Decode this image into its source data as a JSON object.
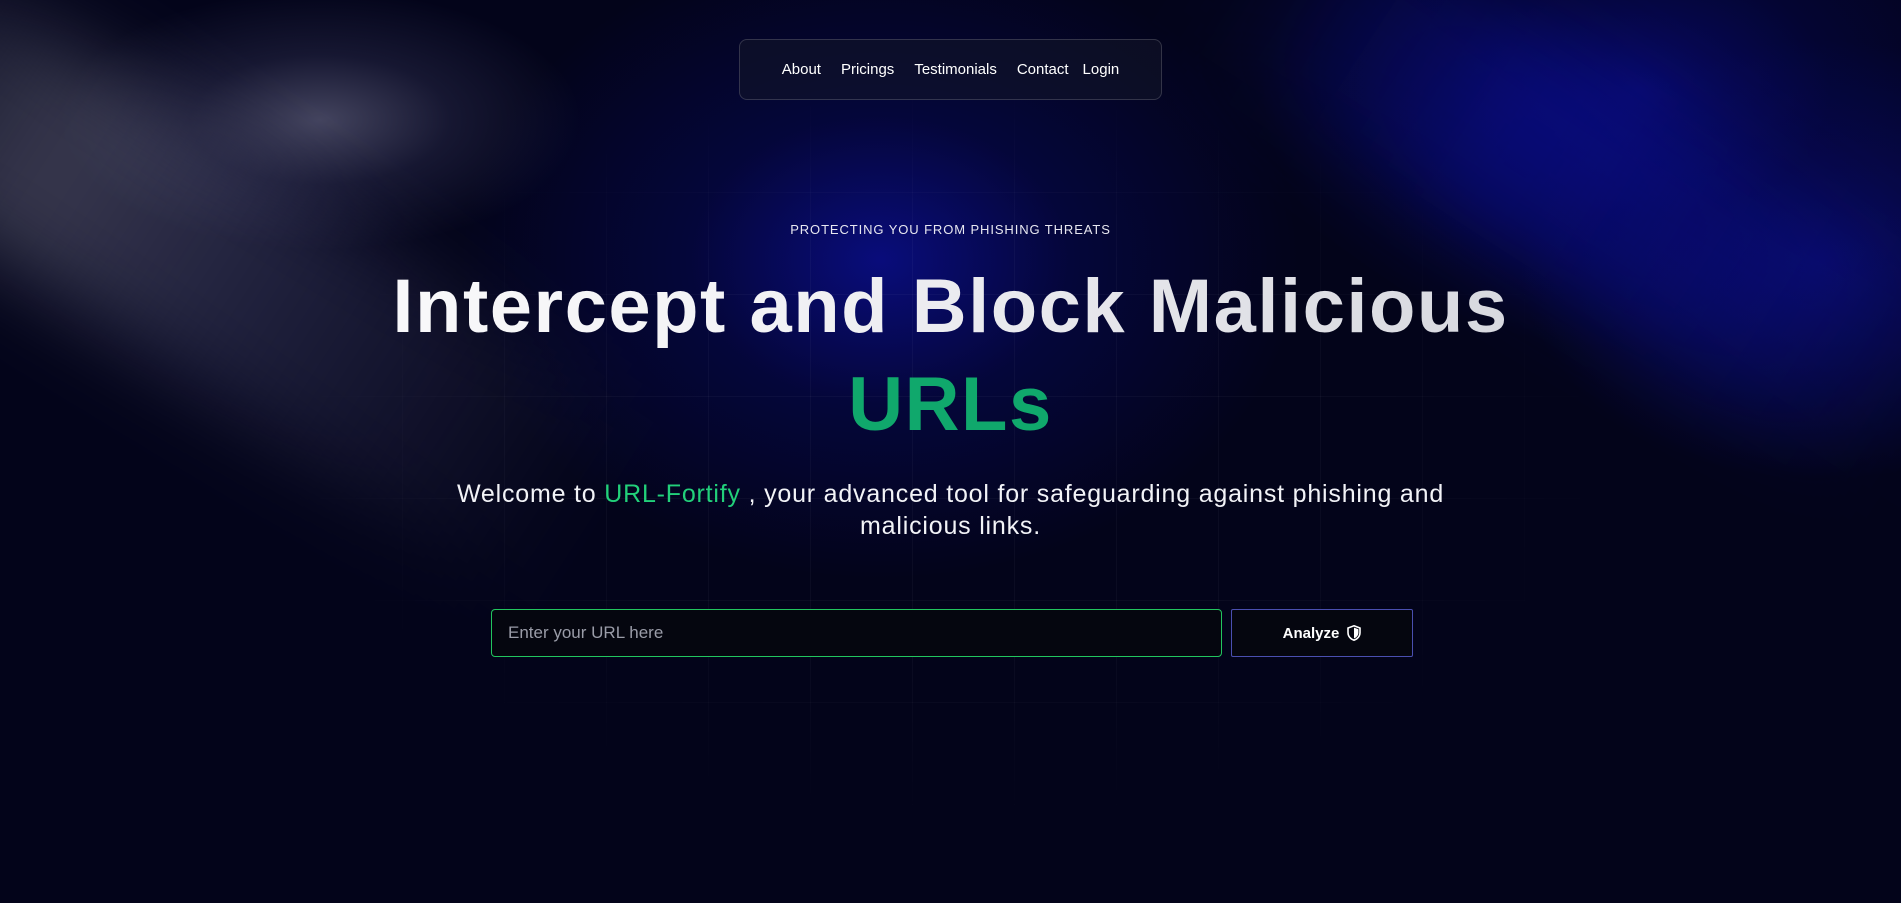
{
  "nav": {
    "items": [
      "About",
      "Pricings",
      "Testimonials",
      "Contact"
    ],
    "login_label": "Login"
  },
  "hero": {
    "eyebrow": "PROTECTING YOU FROM PHISHING THREATS",
    "headline_line1": "Intercept and Block Malicious",
    "headline_line2": "URLs",
    "subtitle_prefix": "Welcome to",
    "brand_name": "URL-Fortify",
    "subtitle_suffix": ", your advanced tool for safeguarding against phishing and malicious links."
  },
  "form": {
    "url_placeholder": "Enter your URL here",
    "url_value": "",
    "analyze_label": "Analyze",
    "analyze_icon": "shield-icon"
  },
  "colors": {
    "background": "#03041a",
    "accent_green": "#10a86c",
    "brand_green": "#22d07a",
    "input_border": "#22c55e",
    "button_border": "#4a4fb0"
  }
}
